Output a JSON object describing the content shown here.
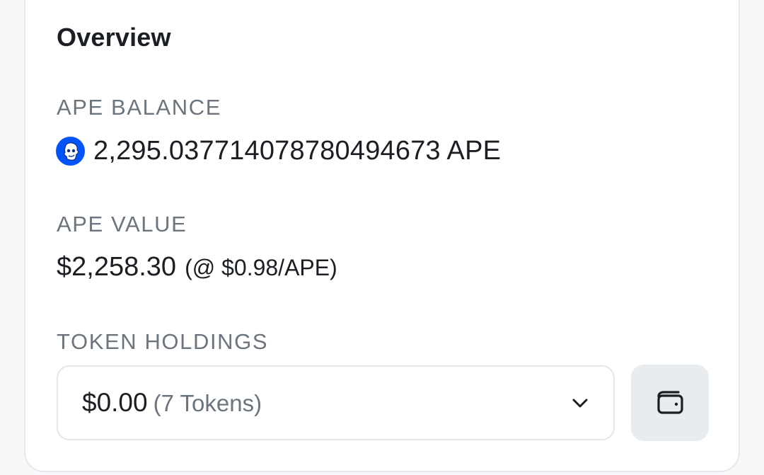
{
  "overview": {
    "title": "Overview"
  },
  "balance": {
    "label": "APE BALANCE",
    "amount": "2,295.03771407878049467​3 APE",
    "icon": "ape-token-icon"
  },
  "value": {
    "label": "APE VALUE",
    "usd": "$2,258.30",
    "rate": "(@ $0.98/APE)"
  },
  "holdings": {
    "label": "TOKEN HOLDINGS",
    "value": "$0.00",
    "count": "(7 Tokens)",
    "dropdown_icon": "chevron-down-icon",
    "wallet_icon": "wallet-icon"
  },
  "colors": {
    "accent": "#0054f9",
    "label": "#6c757d",
    "text": "#1b1f24",
    "button_bg": "#e9ecef"
  }
}
